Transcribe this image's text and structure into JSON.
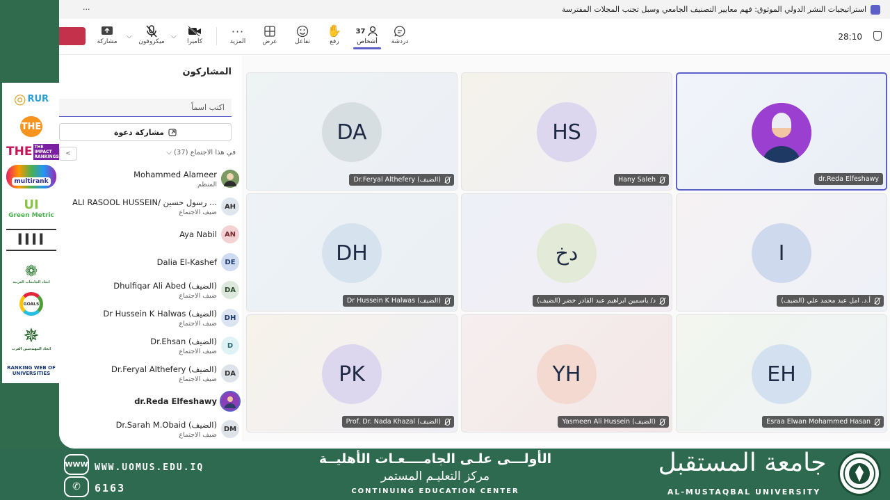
{
  "window": {
    "menu_label": "···",
    "title": "استراتيجيات النشر الدولي الموثوق: فهم معايير التصنيف الجامعي وسبل تجنب المجلات المفترسة"
  },
  "toolbar": {
    "chat": "دردشة",
    "people": "أشخاص",
    "people_count": "37",
    "raise": "رفع",
    "react": "تفاعل",
    "view": "عرض",
    "more": "المزيد",
    "camera": "كاميرا",
    "mic": "ميكروفون",
    "share": "مشاركة",
    "timer": "28:10"
  },
  "panel": {
    "title": "المشاركون",
    "search_placeholder": "اكتب اسماً",
    "invite": "مشاركة دعوة",
    "section": "في هذا الاجتماع (37)",
    "participants": [
      {
        "name": "Mohammed Alameer",
        "sub": "المنظم",
        "initials": ""
      },
      {
        "name": "ALI RASOOL HUSSEIN/ رسول حسين ...",
        "sub": "ضيف الاجتماع",
        "initials": "AH"
      },
      {
        "name": "Aya Nabil",
        "sub": "",
        "initials": "AN"
      },
      {
        "name": "Dalia El-Kashef",
        "sub": "",
        "initials": "DE"
      },
      {
        "name": "Dhulfiqar Ali Abed (الضيف)",
        "sub": "ضيف الاجتماع",
        "initials": "DA"
      },
      {
        "name": "Dr Hussein K Halwas (الضيف)",
        "sub": "ضيف الاجتماع",
        "initials": "DH"
      },
      {
        "name": "Dr.Ehsan (الضيف)",
        "sub": "ضيف الاجتماع",
        "initials": "D"
      },
      {
        "name": "Dr.Feryal Althefery (الضيف)",
        "sub": "ضيف الاجتماع",
        "initials": "DA"
      },
      {
        "name": "dr.Reda Elfeshawy",
        "sub": "",
        "initials": ""
      },
      {
        "name": "Dr.Sarah M.Obaid (الضيف)",
        "sub": "ضيف الاجتماع",
        "initials": "DM"
      }
    ]
  },
  "tiles": [
    {
      "initials": "",
      "label": "dr.Reda Elfeshawy",
      "muted": false
    },
    {
      "initials": "HS",
      "label": "Hany Saleh",
      "muted": true
    },
    {
      "initials": "DA",
      "label": "Dr.Feryal Althefery (الضيف)",
      "muted": true
    },
    {
      "initials": "I",
      "label": "أ.د. امل عبد محمد علي (الضيف)",
      "muted": true
    },
    {
      "initials": "دخ",
      "label": "د/ ياسمين ابراهيم عبد القادر خضر (الضيف)",
      "muted": true
    },
    {
      "initials": "DH",
      "label": "Dr Hussein K Halwas (الضيف)",
      "muted": true
    },
    {
      "initials": "EH",
      "label": "Esraa Elwan Mohammed Hasan",
      "muted": true
    },
    {
      "initials": "YH",
      "label": "Yasmeen Ali Hussein (الضيف)",
      "muted": true
    },
    {
      "initials": "PK",
      "label": "Prof. Dr. Nada Khazal (الضيف)",
      "muted": true
    }
  ],
  "logos": [
    "RUR",
    "THE",
    "THE IMPACT RANKINGS",
    "multirank",
    "Green Metric",
    "ΙΙΙΙ",
    "اتحاد الجامعات العربية",
    "GOALS",
    "اتحاد المهندسين العرب",
    "RANKING WEB OF UNIVERSITIES"
  ],
  "footer": {
    "website": "WWW.UOMUS.EDU.IQ",
    "phone": "6163",
    "www_icon": "WWW",
    "slogan": "الأولـــى علـى الجامــــعـات الأهليــة",
    "center_ar": "مركز التعليـم المستمر",
    "center_en": "CONTINUING EDUCATION CENTER",
    "uni_ar": "جامعة المستقبل",
    "uni_en": "AL-MUSTAQBAL UNIVERSITY"
  }
}
